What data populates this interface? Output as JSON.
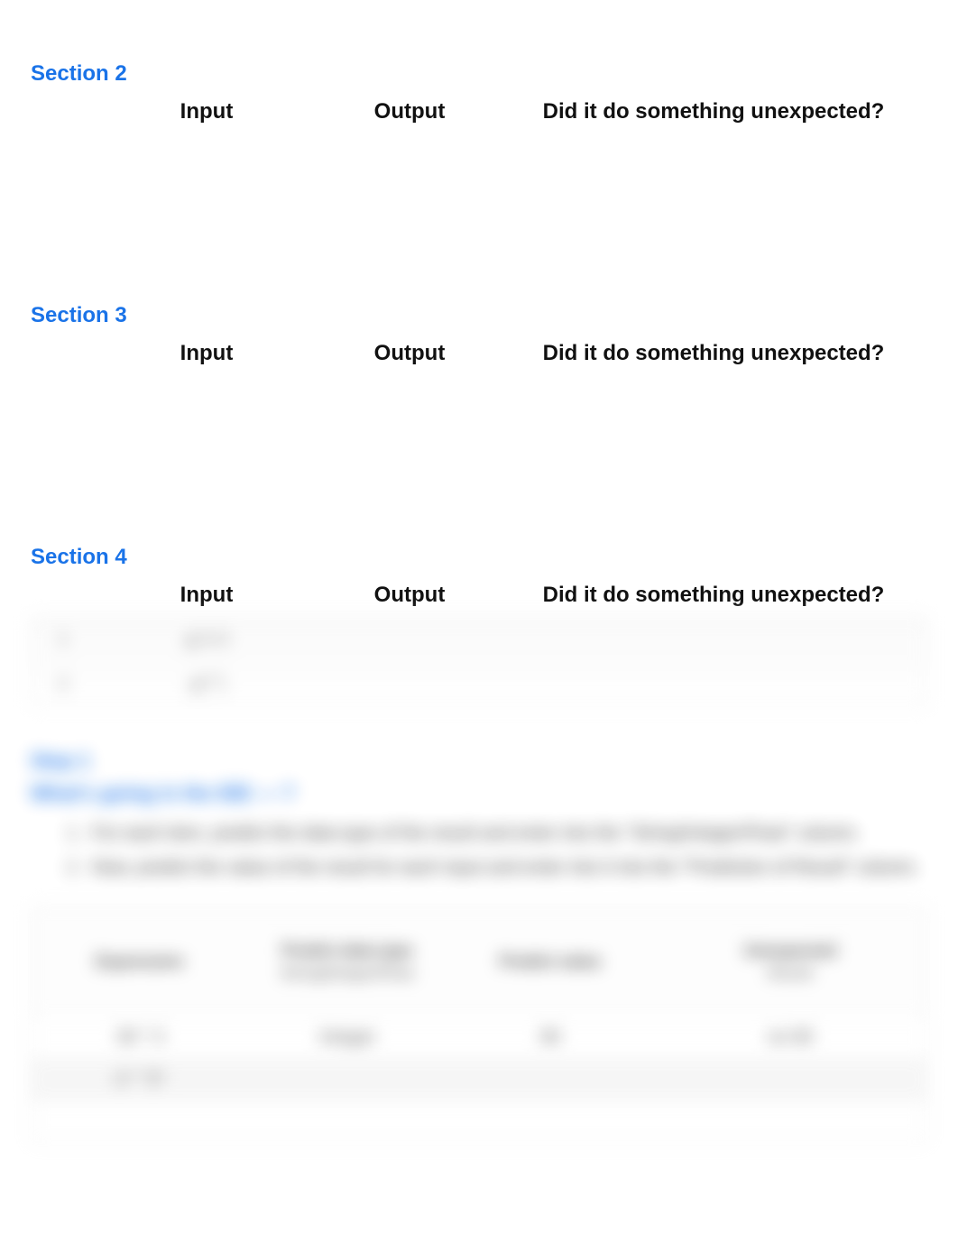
{
  "sections": [
    {
      "title": "Section 2",
      "headers": {
        "input": "Input",
        "output": "Output",
        "unexpected": "Did it do something unexpected?"
      }
    },
    {
      "title": "Section 3",
      "headers": {
        "input": "Input",
        "output": "Output",
        "unexpected": "Did it do something unexpected?"
      }
    },
    {
      "title": "Section 4",
      "headers": {
        "input": "Input",
        "output": "Output",
        "unexpected": "Did it do something unexpected?"
      },
      "faint_rows": [
        {
          "idx": "1",
          "input": "g(\"a\")"
        },
        {
          "idx": "2",
          "input": "g(\"\")"
        }
      ]
    }
  ],
  "step": {
    "heading": "Step 1",
    "subheading": "What's going in the IDE — ?",
    "items": [
      "For each item, predict the data type of the result and enter into the \"String/Integer/Float\" column.",
      "Now, predict the value of the result for each input and enter into it into the \"Prediction of Result\" column."
    ]
  },
  "pred_table": {
    "headers": {
      "expression": "Expression",
      "type_line1": "Predict data type",
      "type_line2": "String/Integer/Float",
      "value": "Predict value",
      "unexpected_line1": "Unexpected",
      "unexpected_line2": "Result"
    },
    "rows": [
      {
        "expression": "30 * 3",
        "type": "Integer",
        "value": "90",
        "unexpected": "no   90"
      },
      {
        "expression": "3 * \"3\"",
        "type": "",
        "value": "",
        "unexpected": ""
      },
      {
        "expression": "",
        "type": "",
        "value": "",
        "unexpected": ""
      }
    ]
  }
}
